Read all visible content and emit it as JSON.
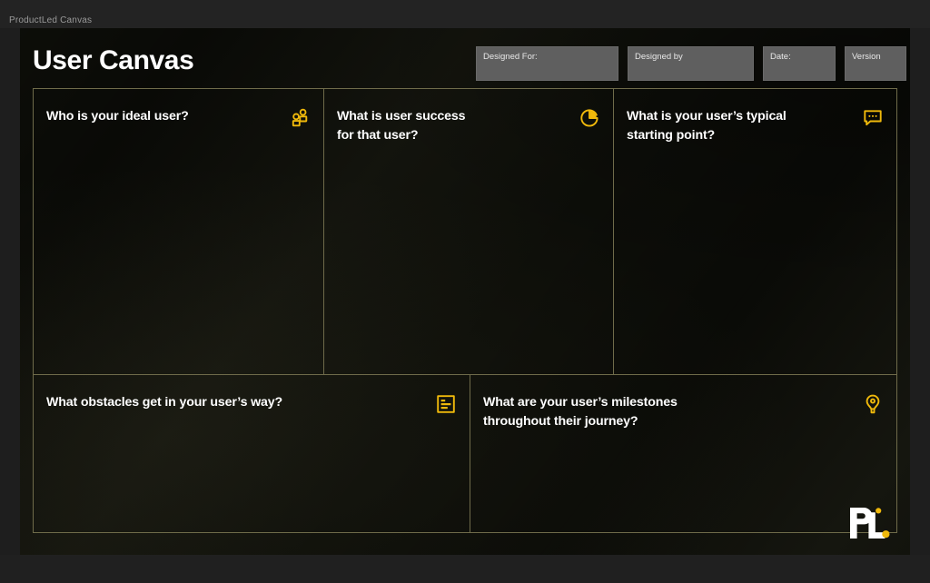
{
  "window": {
    "document_name": "ProductLed Canvas"
  },
  "canvas": {
    "title": "User Canvas",
    "meta_boxes": [
      {
        "label": "Designed For:",
        "value": ""
      },
      {
        "label": "Designed by",
        "value": ""
      },
      {
        "label": "Date:",
        "value": ""
      },
      {
        "label": "Version",
        "value": ""
      }
    ],
    "cells": [
      {
        "title": "Who is your ideal user?",
        "icon": "users-icon",
        "body": ""
      },
      {
        "title": "What is user success\nfor that user?",
        "icon": "pie-chart-icon",
        "body": ""
      },
      {
        "title": "What is your user’s typical\nstarting point?",
        "icon": "speech-bubble-icon",
        "body": ""
      },
      {
        "title": "What obstacles get in your user’s way?",
        "icon": "list-document-icon",
        "body": ""
      },
      {
        "title": "What are your user’s milestones\nthroughout their journey?",
        "icon": "map-pin-icon",
        "body": ""
      }
    ],
    "logo": {
      "name": "productled-logo",
      "text": "PL"
    },
    "colors": {
      "accent": "#f0b90b",
      "background": "#0d0e09",
      "grid_line": "#6f6b4a",
      "title_text": "#ffffff",
      "meta_box": "#5f5f5f"
    }
  }
}
